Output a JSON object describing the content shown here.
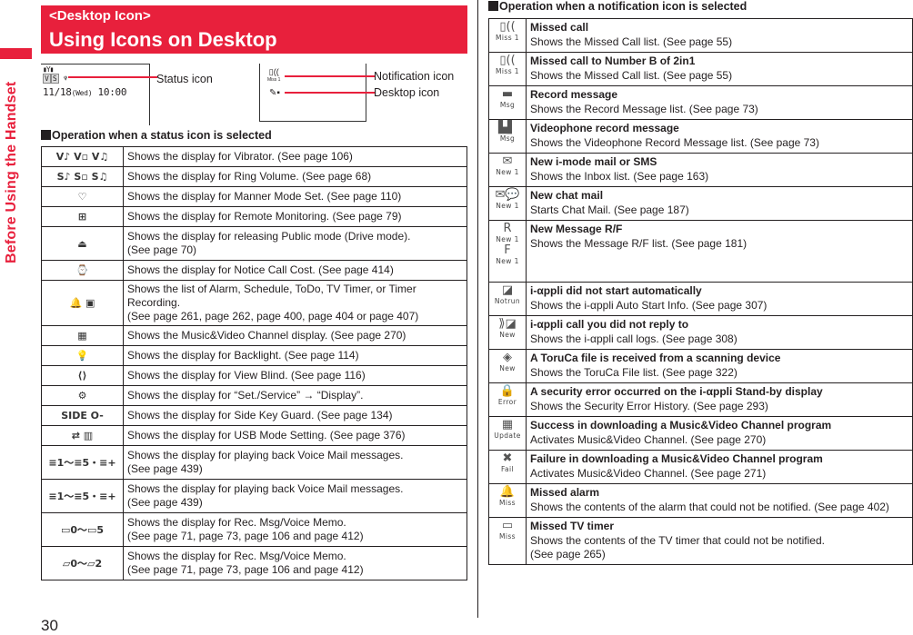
{
  "side_tab": {
    "label": "Before Using the Handset"
  },
  "banner": {
    "subtitle": "<Desktop Icon>",
    "title": "Using Icons on Desktop"
  },
  "screen_preview": {
    "status_bar_top": "▮Y▮",
    "status_icons": [
      "V",
      "S",
      "♆"
    ],
    "clock_date": "11/18",
    "clock_day": "(Wed)",
    "clock_time": "10:00",
    "notification_icon": "▯((",
    "notification_caption": "Miss 1",
    "desktop_icon": "✎▪"
  },
  "callouts": {
    "status_icon": "Status icon",
    "notification_icon": "Notification icon",
    "desktop_icon": "Desktop icon"
  },
  "status_section": {
    "heading": "Operation when a status icon is selected",
    "rows": [
      {
        "icon": "V♪ V▫ V♫",
        "text": "Shows the display for Vibrator. (See page 106)"
      },
      {
        "icon": "S♪ S▫ S♫",
        "text": "Shows the display for Ring Volume. (See page 68)"
      },
      {
        "icon": "♡",
        "text": "Shows the display for Manner Mode Set. (See page 110)"
      },
      {
        "icon": "⊞",
        "text": "Shows the display for Remote Monitoring. (See page 79)"
      },
      {
        "icon": "⏏",
        "text": "Shows the display for releasing Public mode (Drive mode).\n(See page 70)"
      },
      {
        "icon": "⌚",
        "text": "Shows the display for Notice Call Cost. (See page 414)"
      },
      {
        "icon": "🔔 ▣",
        "text": "Shows the list of Alarm, Schedule, ToDo, TV Timer, or Timer Recording.\n(See page 261, page 262, page 400, page 404 or page 407)"
      },
      {
        "icon": "▦",
        "text": "Shows the Music&Video Channel display. (See page 270)"
      },
      {
        "icon": "💡",
        "text": "Shows the display for Backlight. (See page 114)"
      },
      {
        "icon": "⟨⟩",
        "text": "Shows the display for View Blind. (See page 116)"
      },
      {
        "icon": "⚙",
        "text": "Shows the display for “Set./Service” → “Display”."
      },
      {
        "icon": "SIDE O-",
        "text": "Shows the display for Side Key Guard. (See page 134)"
      },
      {
        "icon": "⇄ ▥",
        "text": "Shows the display for USB Mode Setting. (See page 376)"
      },
      {
        "icon": "≡1〜≡5・≡+",
        "text": "Shows the display for playing back Voice Mail messages.\n(See page 439)"
      },
      {
        "icon": "≡1〜≡5・≡+",
        "text": "Shows the display for playing back Voice Mail messages.\n(See page 439)"
      },
      {
        "icon": "▭0〜▭5",
        "text": "Shows the display for Rec. Msg/Voice Memo.\n(See page 71, page 73, page 106 and page 412)"
      },
      {
        "icon": "▱0〜▱2",
        "text": "Shows the display for Rec. Msg/Voice Memo.\n(See page 71, page 73, page 106 and page 412)"
      }
    ]
  },
  "notification_section": {
    "heading": "Operation when a notification icon is selected",
    "rows": [
      {
        "glyph": "▯((",
        "caption": "Miss 1",
        "title": "Missed call",
        "desc": "Shows the Missed Call list. (See page 55)"
      },
      {
        "glyph": "▯((",
        "caption": "Miss 1",
        "title": "Missed call to Number B of 2in1",
        "desc": "Shows the Missed Call list. (See page 55)"
      },
      {
        "glyph": "▬",
        "caption": "Msg",
        "title": "Record message",
        "desc": "Shows the Record Message list. (See page 73)"
      },
      {
        "glyph": "▙▌",
        "caption": "Msg",
        "title": "Videophone record message",
        "desc": "Shows the Videophone Record Message list. (See page 73)"
      },
      {
        "glyph": "✉",
        "caption": "New 1",
        "title": "New i-mode mail or SMS",
        "desc": "Shows the Inbox list. (See page 163)"
      },
      {
        "glyph": "✉💬",
        "caption": "New 1",
        "title": "New chat mail",
        "desc": "Starts Chat Mail. (See page 187)"
      },
      {
        "glyph": "R",
        "caption": "New 1",
        "glyph2": "F",
        "caption2": "New 1",
        "title": "New Message R/F",
        "desc": "Shows the Message R/F list. (See page 181)"
      },
      {
        "glyph": "◪",
        "caption": "Notrun",
        "title": "i-αppli did not start automatically",
        "desc": "Shows the i-αppli Auto Start Info. (See page 307)"
      },
      {
        "glyph": "⟫◪",
        "caption": "New",
        "title": "i-αppli call you did not reply to",
        "desc": "Shows the i-αppli call logs. (See page 308)"
      },
      {
        "glyph": "◈",
        "caption": "New",
        "title": "A ToruCa file is received from a scanning device",
        "desc": "Shows the ToruCa File list. (See page 322)"
      },
      {
        "glyph": "🔒",
        "caption": "Error",
        "title": "A security error occurred on the i-αppli Stand-by display",
        "desc": "Shows the Security Error History. (See page 293)"
      },
      {
        "glyph": "▦",
        "caption": "Update",
        "title": "Success in downloading a Music&Video Channel program",
        "desc": "Activates Music&Video Channel. (See page 270)"
      },
      {
        "glyph": "✖",
        "caption": "Fail",
        "title": "Failure in downloading a Music&Video Channel program",
        "desc": "Activates Music&Video Channel. (See page 271)"
      },
      {
        "glyph": "🔔",
        "caption": "Miss",
        "title": "Missed alarm",
        "desc": "Shows the contents of the alarm that could not be notified. (See page 402)"
      },
      {
        "glyph": "▭",
        "caption": "Miss",
        "title": "Missed TV timer",
        "desc": "Shows the contents of the TV timer that could not be notified.\n(See page 265)"
      }
    ]
  },
  "page_number": "30",
  "colors": {
    "accent": "#e8203c",
    "text": "#231f20"
  }
}
